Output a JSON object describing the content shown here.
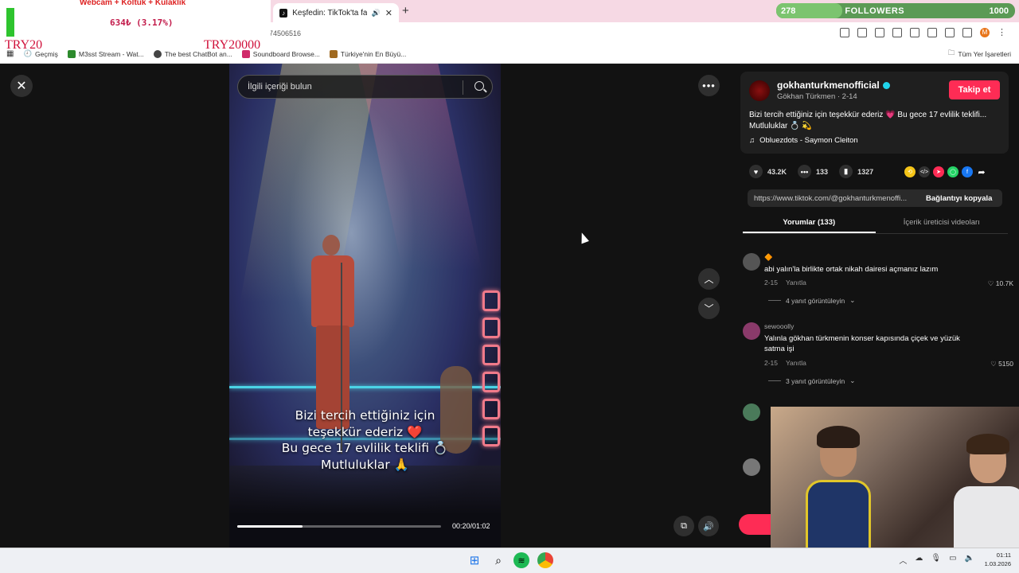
{
  "browser": {
    "active_tab_title": "Keşfedin: TikTok'ta favori vi",
    "url_tail": "74506516",
    "new_tab_symbol": "+",
    "bookmarks": [
      {
        "label": "Geçmiş"
      },
      {
        "label": "M3sst Stream - Wat..."
      },
      {
        "label": "The best ChatBot an..."
      },
      {
        "label": "Soundboard Browse..."
      },
      {
        "label": "Türkiye'nin En Büyü..."
      }
    ],
    "bookmarks_right": "Tüm Yer İşaretleri",
    "profile_initial": "M"
  },
  "stream_overlay": {
    "goal_title": "Webcam + Koltuk + Kulaklık",
    "goal_amount": "634₺ (3.17%)",
    "goal_progress": 0.0317,
    "promo_left": "TRY20",
    "promo_mid": "TRY20000",
    "followers_count": "278",
    "followers_label": "FOLLOWERS",
    "followers_goal": "1000",
    "followers_progress": 0.278
  },
  "viewer": {
    "close_symbol": "✕",
    "search_placeholder": "İlgili içeriği bulun",
    "more_symbol": "•••",
    "caption_lines": [
      "Bizi tercih ettiğiniz için",
      "teşekkür ederiz ❤️",
      "Bu gece 17 evlilik teklifi 💍",
      "Mutluluklar 🙏"
    ],
    "time": "00:20/01:02",
    "progress": 0.32,
    "nav_up": "︿",
    "nav_down": "﹀"
  },
  "post": {
    "username": "gokhanturkmenofficial",
    "subname": "Gökhan Türkmen · 2-14",
    "follow_label": "Takip et",
    "description": "Bizi tercih ettiğiniz için teşekkür ederiz 💗 Bu gece 17 evlilik teklifi... Mutluluklar 💍 💫",
    "music": "Obluezdots - Saymon Cleiton",
    "likes": "43.2K",
    "comments": "133",
    "saves": "1327",
    "link_url": "https://www.tiktok.com/@gokhanturkmenoffi...",
    "copy_label": "Bağlantıyı kopyala",
    "tab_comments": "Yorumlar (133)",
    "tab_creator": "İçerik üreticisi videoları"
  },
  "comments": [
    {
      "user": "🔶",
      "text": "abi yalın'la birlikte ortak nikah dairesi açmanız lazım",
      "date": "2-15",
      "reply": "Yanıtla",
      "likes": "10.7K",
      "replies": "4 yanıt görüntüleyin"
    },
    {
      "user": "sewooolly",
      "text": "Yalınla gökhan türkmenin konser kapısında çiçek ve yüzük satma işi",
      "date": "2-15",
      "reply": "Yanıtla",
      "likes": "5150",
      "replies": "3 yanıt görüntüleyin"
    }
  ],
  "taskbar": {
    "time": "01:11",
    "date": "1.03.2026"
  },
  "colors": {
    "accent": "#fe2c55",
    "verified": "#20d5ec"
  }
}
